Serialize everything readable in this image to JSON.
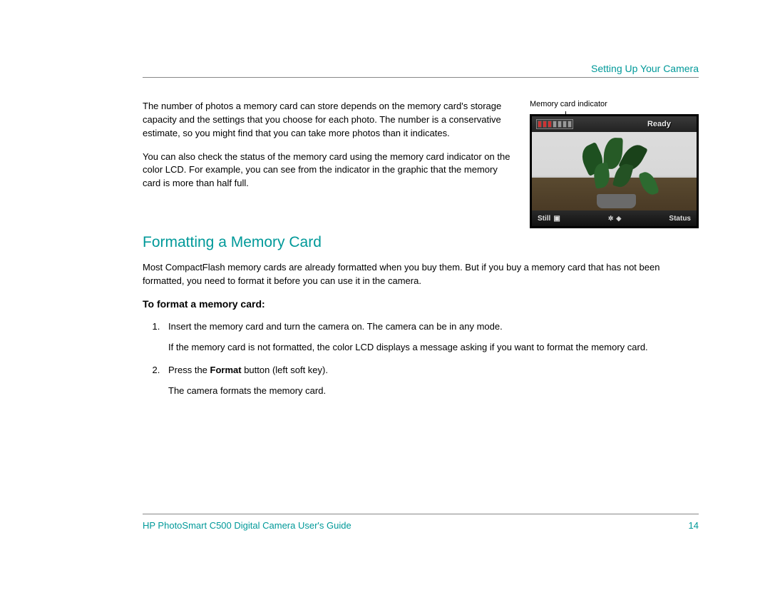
{
  "header": {
    "section": "Setting Up Your Camera"
  },
  "intro": {
    "p1": "The number of photos a memory card can store depends on the memory card's storage capacity and the settings that you choose for each photo. The number is a conservative estimate, so you might find that you can take more photos than it indicates.",
    "p2": "You can also check the status of the memory card using the memory card indicator on the color LCD. For example, you can see from the indicator in the graphic that the memory card is more than half full."
  },
  "figure": {
    "caption": "Memory card indicator",
    "ready_label": "Ready",
    "left_soft": "Still",
    "right_soft": "Status"
  },
  "section_heading": "Formatting a Memory Card",
  "section_intro": "Most CompactFlash memory cards are already formatted when you buy them. But if you buy a memory card that has not been formatted, you need to format it before you can use it in the camera.",
  "procedure_heading": "To format a memory card:",
  "steps": {
    "s1": "Insert the memory card and turn the camera on. The camera can be in any mode.",
    "s1_sub": "If the memory card is not formatted, the color LCD displays a message asking if you want to format the memory card.",
    "s2_pre": "Press the ",
    "s2_bold": "Format",
    "s2_post": " button (left soft key).",
    "s2_sub": "The camera formats the memory card."
  },
  "footer": {
    "title": "HP PhotoSmart C500 Digital Camera User's Guide",
    "page": "14"
  }
}
